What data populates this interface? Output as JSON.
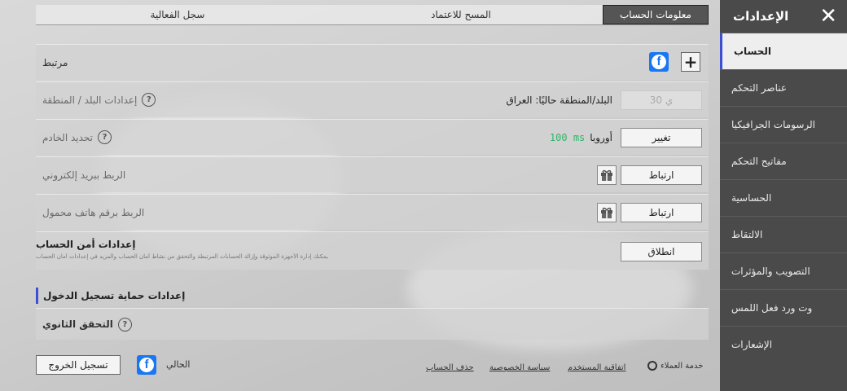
{
  "tabs": [
    "سجل الفعالية",
    "المسح للاعتماد",
    "معلومات الحساب"
  ],
  "sidebar": {
    "title": "الإعدادات",
    "items": [
      "الحساب",
      "عناصر التحكم",
      "الرسومات الجرافيكيا",
      "مفاتيح التحكم",
      "الحساسية",
      "الالتقاط",
      "التصويب والمؤثرات",
      "وت ورد فعل اللمس",
      "الإشعارات"
    ]
  },
  "rows": {
    "linked": {
      "label": "مرتبط"
    },
    "region": {
      "label": "إعدادات البلد / المنطقة",
      "current": "البلد/المنطقة حاليًا: العراق",
      "button": "30 ي"
    },
    "server": {
      "label": "تحديد الخادم",
      "server": "أوروبا",
      "ping": "100 ms",
      "button": "تغيير"
    },
    "email": {
      "label": "الربط ببريد إلكتروني",
      "button": "ارتباط"
    },
    "phone": {
      "label": "الربط برقم هاتف محمول",
      "button": "ارتباط"
    },
    "security": {
      "title": "إعدادات أمن الحساب",
      "desc": "يمكنك إدارة الأجهزة الموثوقة وإزالة الحسابات المرتبطة والتحقق من نشاط أمان الحساب والمزيد في إعدادات أمان الحساب",
      "button": "انطلاق"
    },
    "protection": {
      "title": "إعدادات حماية تسجيل الدخول"
    },
    "twofa": {
      "label": "التحقق الثانوي"
    }
  },
  "footer": {
    "current_label": "الحالي",
    "logout": "تسجيل الخروج",
    "links": [
      "حذف الحساب",
      "سياسة الخصوصية",
      "اتفاقية المستخدم"
    ],
    "support": "خدمة العملاء"
  },
  "colors": {
    "accent": "#3b4fd0",
    "ping": "#2fb56a",
    "facebook": "#1877f2",
    "sidebar": "#4a4a4a"
  }
}
